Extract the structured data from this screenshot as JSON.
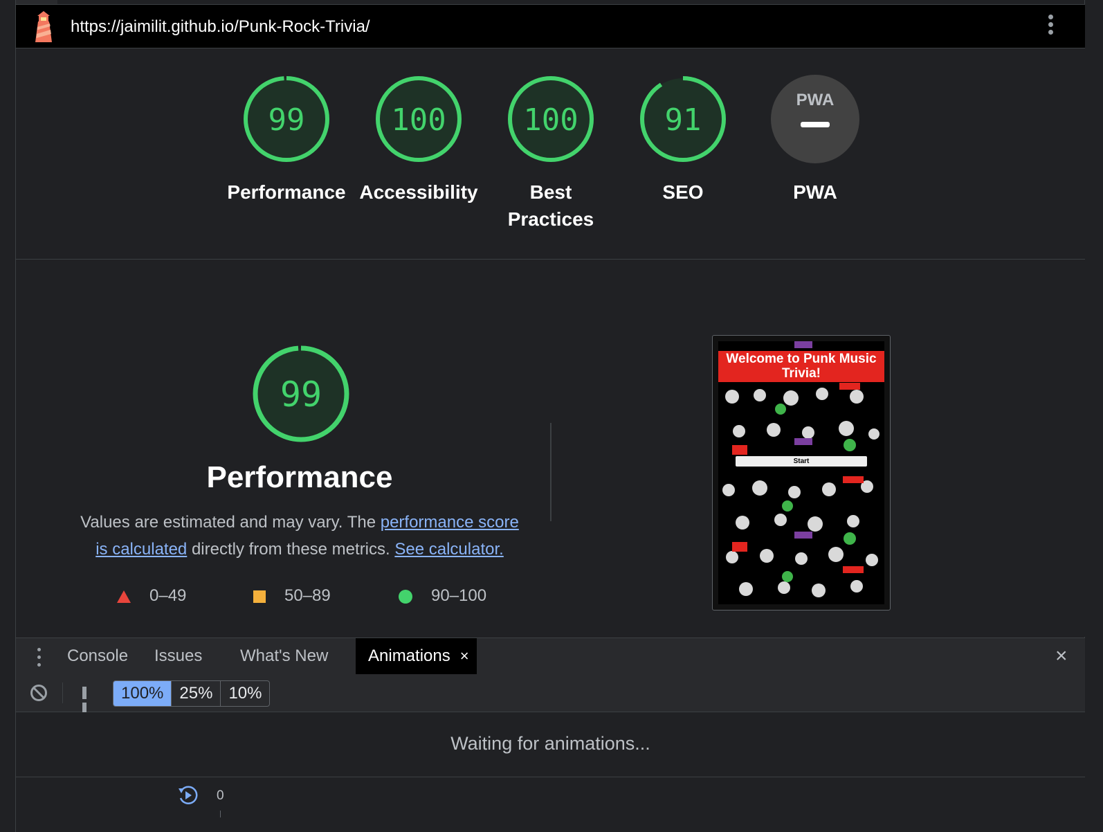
{
  "report": {
    "url": "https://jaimilit.github.io/Punk-Rock-Trivia/"
  },
  "categories": [
    {
      "score": "99",
      "label": "Performance",
      "fraction": 0.99
    },
    {
      "score": "100",
      "label": "Accessibility",
      "fraction": 1.0
    },
    {
      "score": "100",
      "label": "Best Practices",
      "fraction": 1.0
    },
    {
      "score": "91",
      "label": "SEO",
      "fraction": 0.91
    },
    {
      "badge": "PWA",
      "label": "PWA"
    }
  ],
  "performance": {
    "score": "99",
    "title": "Performance",
    "desc_prefix": "Values are estimated and may vary. The ",
    "link_score": "performance score is calculated",
    "desc_middle": " directly from these metrics. ",
    "link_calc": "See calculator.",
    "legend": [
      {
        "range": "0–49",
        "shape": "triangle-icon",
        "color": "#e8453c"
      },
      {
        "range": "50–89",
        "shape": "square-icon",
        "color": "#f4b03c"
      },
      {
        "range": "90–100",
        "shape": "circle-icon",
        "color": "#43d36c"
      }
    ],
    "screenshot": {
      "banner": "Welcome to Punk Music Trivia!",
      "start": "Start"
    }
  },
  "drawer": {
    "tabs": [
      "Console",
      "Issues",
      "What's New",
      "Animations"
    ],
    "active_tab": "Animations",
    "close_symbol": "×"
  },
  "animations": {
    "speeds": [
      "100%",
      "25%",
      "10%"
    ],
    "active_speed": "100%",
    "waiting": "Waiting for animations...",
    "timeline_zero": "0"
  },
  "colors": {
    "pass": "#43d36c",
    "pass_bg": "#1e3226",
    "link": "#8ab4f8",
    "accent": "#7cacf8"
  }
}
